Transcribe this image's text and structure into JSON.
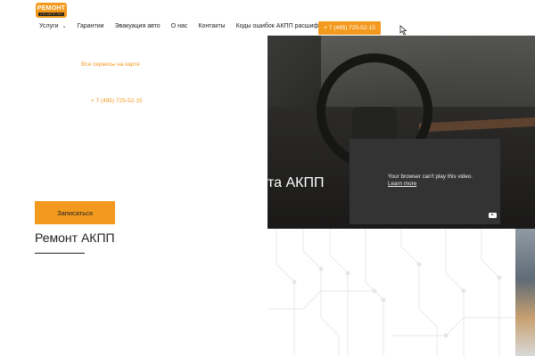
{
  "logo": {
    "line1": "РЕМОНТ",
    "line2": "СТО АКПП ЛИЗ"
  },
  "nav": {
    "items": [
      {
        "label": "Услуги",
        "has_dropdown": true
      },
      {
        "label": "Гарантии"
      },
      {
        "label": "Эвакуация авто"
      },
      {
        "label": "О нас"
      },
      {
        "label": "Контакты"
      },
      {
        "label": "Коды ошибок АКПП расшифровка"
      }
    ],
    "phone_button": "+ 7 (495) 725-52-15"
  },
  "links": {
    "map": "Все сервисы на карте",
    "phone": "+ 7 (495) 725-52-15"
  },
  "hero": {
    "title_fragment": "та АКПП"
  },
  "video": {
    "message": "Your browser can't play this video.",
    "learn_more": "Learn more"
  },
  "cta": {
    "label": "Записаться"
  },
  "section": {
    "title": "Ремонт АКПП"
  },
  "colors": {
    "accent": "#f39a1e",
    "text": "#222222",
    "video_bg": "#333333"
  },
  "icons": {
    "dropdown": "chevron-down-icon",
    "cursor": "text-cursor-icon",
    "video_logo": "youtube-icon"
  }
}
